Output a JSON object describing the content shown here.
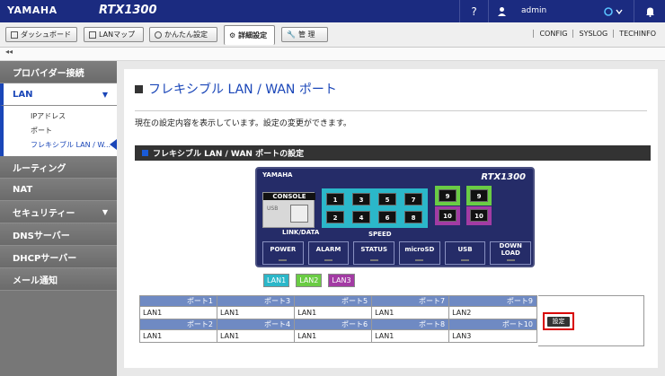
{
  "header": {
    "logo": "YAMAHA",
    "model": "RTX1300",
    "help": "?",
    "user": "admin",
    "colors": {
      "bar": "#1b2b80"
    }
  },
  "toolbar": {
    "buttons": [
      {
        "label": "ダッシュボード",
        "icon": "dashboard-icon"
      },
      {
        "label": "LANマップ",
        "icon": "lanmap-icon"
      },
      {
        "label": "かんたん設定",
        "icon": "wizard-icon"
      },
      {
        "label": "詳細設定",
        "icon": "gear-icon"
      },
      {
        "label": "管 理",
        "icon": "wrench-icon"
      }
    ],
    "links": [
      "CONFIG",
      "SYSLOG",
      "TECHINFO"
    ]
  },
  "subbar": {
    "collapse": "◂◂"
  },
  "sidebar": {
    "items": [
      {
        "label": "プロバイダー接続"
      },
      {
        "label": "LAN",
        "arrow": "▼"
      },
      {
        "label": "ルーティング"
      },
      {
        "label": "NAT"
      },
      {
        "label": "セキュリティー",
        "arrow": "▼"
      },
      {
        "label": "DNSサーバー"
      },
      {
        "label": "DHCPサーバー"
      },
      {
        "label": "メール通知"
      }
    ],
    "lan_sub": [
      "IPアドレス",
      "ポート",
      "フレキシブル LAN / W..."
    ]
  },
  "main": {
    "title": "フレキシブル LAN / WAN ポート",
    "description": "現在の設定内容を表示しています。設定の変更ができます。",
    "section": "フレキシブル LAN / WAN ポートの設定"
  },
  "device": {
    "logo": "YAMAHA",
    "model": "RTX1300",
    "console": "CONSOLE",
    "usb": "USB",
    "ports_top": [
      "1",
      "3",
      "5",
      "7"
    ],
    "ports_bottom": [
      "2",
      "4",
      "6",
      "8"
    ],
    "ports_right": [
      "9",
      "10",
      "9",
      "10"
    ],
    "link_label": "LINK/DATA",
    "speed_label": "SPEED",
    "leds": [
      "POWER",
      "ALARM",
      "STATUS",
      "microSD",
      "USB",
      "DOWN\nLOAD"
    ]
  },
  "legend": [
    {
      "label": "LAN1",
      "color": "#2bb7c9"
    },
    {
      "label": "LAN2",
      "color": "#6acc44"
    },
    {
      "label": "LAN3",
      "color": "#a33ba4"
    }
  ],
  "port_table": {
    "row1_headers": [
      "ポート1",
      "ポート3",
      "ポート5",
      "ポート7",
      "ポート9"
    ],
    "row1_values": [
      "LAN1",
      "LAN1",
      "LAN1",
      "LAN1",
      "LAN2"
    ],
    "row2_headers": [
      "ポート2",
      "ポート4",
      "ポート6",
      "ポート8",
      "ポート10"
    ],
    "row2_values": [
      "LAN1",
      "LAN1",
      "LAN1",
      "LAN1",
      "LAN3"
    ]
  },
  "settings_button": "設定"
}
